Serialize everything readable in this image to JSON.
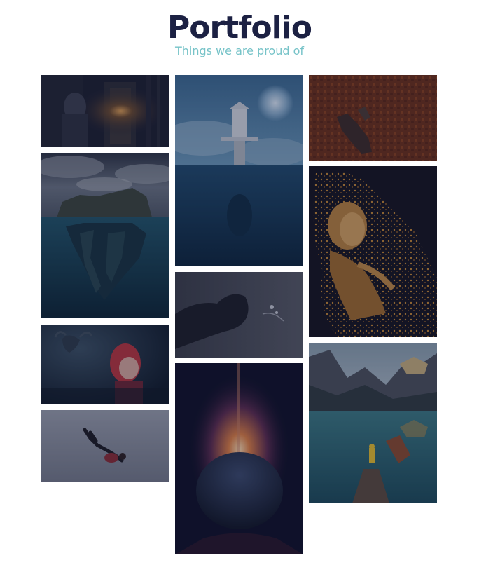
{
  "header": {
    "title": "Portfolio",
    "subtitle": "Things we are proud of"
  },
  "colors": {
    "title": "#1c2143",
    "subtitle": "#76c3c8",
    "overlay": "#161a3a"
  },
  "gallery": {
    "items": [
      {
        "name": "haunted-door-photo",
        "description_icon": "image-icon"
      },
      {
        "name": "floating-island-photo",
        "description_icon": "image-icon"
      },
      {
        "name": "horned-spirit-girl-photo",
        "description_icon": "image-icon"
      },
      {
        "name": "falling-man-photo",
        "description_icon": "image-icon"
      },
      {
        "name": "lighthouse-underwater-photo",
        "description_icon": "image-icon"
      },
      {
        "name": "profile-silhouette-photo",
        "description_icon": "image-icon"
      },
      {
        "name": "planet-sunrise-photo",
        "description_icon": "image-icon"
      },
      {
        "name": "leaves-figure-photo",
        "description_icon": "image-icon"
      },
      {
        "name": "golden-dust-woman-photo",
        "description_icon": "image-icon"
      },
      {
        "name": "mountain-lake-pier-photo",
        "description_icon": "image-icon"
      }
    ]
  }
}
